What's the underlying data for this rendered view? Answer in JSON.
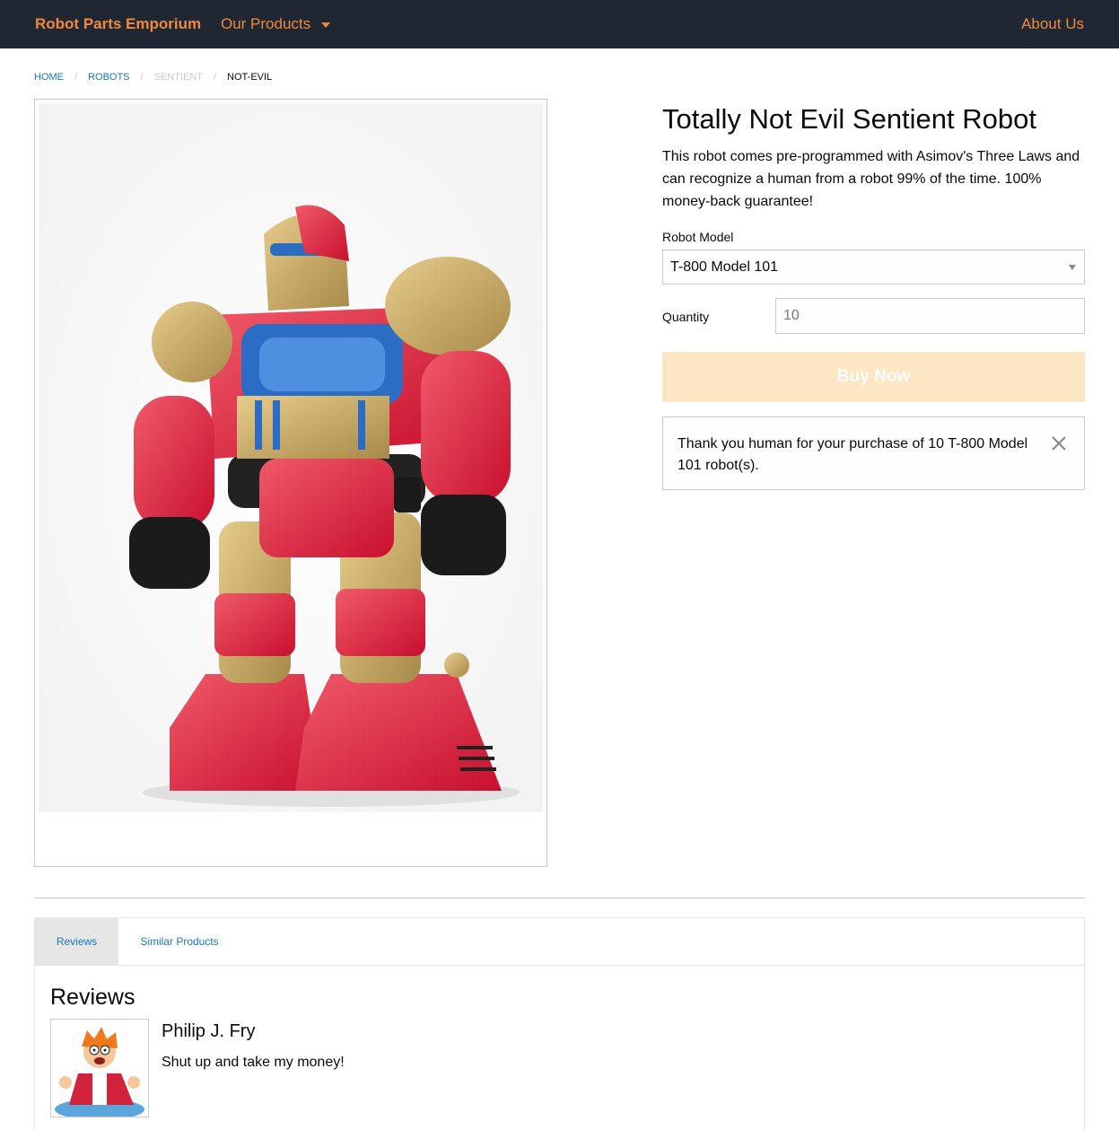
{
  "nav": {
    "brand": "Robot Parts Emporium",
    "products_menu": "Our Products",
    "about": "About Us"
  },
  "breadcrumb": [
    {
      "label": "Home",
      "state": "link"
    },
    {
      "label": "Robots",
      "state": "link"
    },
    {
      "label": "Sentient",
      "state": "disabled"
    },
    {
      "label": "Not-Evil",
      "state": "current"
    }
  ],
  "product": {
    "title": "Totally Not Evil Sentient Robot",
    "description": "This robot comes pre-programmed with Asimov's Three Laws and can recognize a human from a robot 99% of the time. 100% money-back guarantee!",
    "image_icon": "red-gold-toy-robot-image"
  },
  "form": {
    "model_label": "Robot Model",
    "model_selected": "T-800 Model 101",
    "quantity_label": "Quantity",
    "quantity_placeholder": "10",
    "buy_label": "Buy Now"
  },
  "callout": {
    "message": "Thank you human for your purchase of 10 T-800 Model 101 robot(s).",
    "close_icon": "close-icon"
  },
  "tabs": [
    {
      "label": "Reviews",
      "active": true
    },
    {
      "label": "Similar Products",
      "active": false
    }
  ],
  "reviews": {
    "heading": "Reviews",
    "items": [
      {
        "name": "Philip J. Fry",
        "text": "Shut up and take my money!",
        "avatar_icon": "cartoon-avatar-icon"
      }
    ]
  },
  "colors": {
    "topbar": "#1f2733",
    "accent": "#f0883d",
    "link": "#1779ba",
    "buy_disabled": "#fde6c3"
  }
}
